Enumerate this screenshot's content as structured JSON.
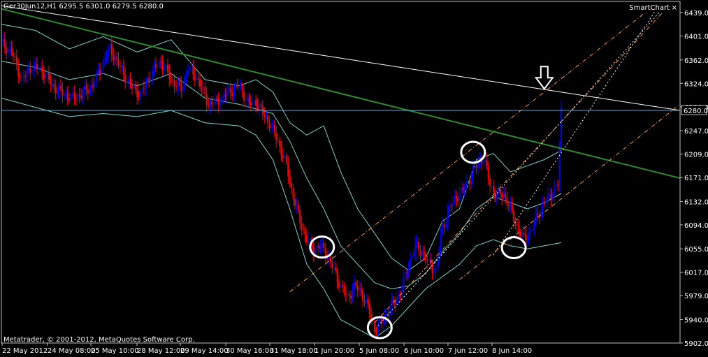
{
  "header": {
    "symbol_info": "Ger30Jun12,H1  6295.5 6301.0 6279.5 6280.0",
    "smartchart_label": "SmartChart",
    "close_glyph": "×"
  },
  "footer": {
    "copyright": "Metatrader, © 2001-2012, MetaQuotes Software Corp."
  },
  "colors": {
    "background": "#000000",
    "axis": "#c0c0c0",
    "bull_candle": "#0000ff",
    "bear_candle": "#ff0000",
    "bollinger": "#7fd3c8",
    "trend_green": "#2e8b2e",
    "trend_white": "#ffffff",
    "channel_orange": "#ff9933",
    "price_line": "#5aa9d6"
  },
  "chart_data": {
    "type": "candlestick",
    "ylim": [
      5902.0,
      6439.0
    ],
    "y_ticks": [
      "6439.0",
      "6401.0",
      "6362.0",
      "6324.0",
      "6286.0",
      "6247.0",
      "6209.0",
      "6171.0",
      "6132.0",
      "6094.0",
      "6055.0",
      "6017.0",
      "5979.0",
      "5940.0",
      "5902.0"
    ],
    "current_price": 6280.0,
    "current_price_label": "6280.0",
    "x_ticks": [
      "22 May 2012",
      "24 May 08:00",
      "25 May 10:00",
      "28 May 12:00",
      "29 May 14:00",
      "30 May 16:00",
      "31 May 18:00",
      "1 Jun 20:00",
      "5 Jun 08:00",
      "6 Jun 10:00",
      "7 Jun 12:00",
      "8 Jun 14:00"
    ],
    "close_path": [
      [
        0,
        6390
      ],
      [
        6,
        6375
      ],
      [
        12,
        6330
      ],
      [
        18,
        6352
      ],
      [
        24,
        6345
      ],
      [
        30,
        6320
      ],
      [
        36,
        6308
      ],
      [
        42,
        6300
      ],
      [
        48,
        6308
      ],
      [
        54,
        6322
      ],
      [
        60,
        6360
      ],
      [
        64,
        6380
      ],
      [
        70,
        6350
      ],
      [
        76,
        6320
      ],
      [
        82,
        6305
      ],
      [
        88,
        6340
      ],
      [
        94,
        6360
      ],
      [
        100,
        6330
      ],
      [
        106,
        6315
      ],
      [
        110,
        6350
      ],
      [
        116,
        6330
      ],
      [
        122,
        6290
      ],
      [
        128,
        6295
      ],
      [
        134,
        6310
      ],
      [
        140,
        6320
      ],
      [
        146,
        6290
      ],
      [
        150,
        6295
      ],
      [
        154,
        6275
      ],
      [
        158,
        6260
      ],
      [
        163,
        6230
      ],
      [
        168,
        6190
      ],
      [
        172,
        6140
      ],
      [
        176,
        6100
      ],
      [
        180,
        6070
      ],
      [
        184,
        6055
      ],
      [
        188,
        6060
      ],
      [
        192,
        6045
      ],
      [
        196,
        6020
      ],
      [
        200,
        5995
      ],
      [
        204,
        5975
      ],
      [
        208,
        5995
      ],
      [
        212,
        5985
      ],
      [
        216,
        5960
      ],
      [
        220,
        5925
      ],
      [
        224,
        5935
      ],
      [
        228,
        5955
      ],
      [
        232,
        5970
      ],
      [
        236,
        5990
      ],
      [
        240,
        6030
      ],
      [
        244,
        6060
      ],
      [
        248,
        6050
      ],
      [
        252,
        6030
      ],
      [
        256,
        6020
      ],
      [
        260,
        6090
      ],
      [
        264,
        6120
      ],
      [
        268,
        6140
      ],
      [
        272,
        6150
      ],
      [
        276,
        6170
      ],
      [
        280,
        6190
      ],
      [
        284,
        6205
      ],
      [
        288,
        6160
      ],
      [
        292,
        6140
      ],
      [
        296,
        6145
      ],
      [
        300,
        6120
      ],
      [
        304,
        6090
      ],
      [
        308,
        6070
      ],
      [
        312,
        6085
      ],
      [
        316,
        6110
      ],
      [
        320,
        6130
      ],
      [
        324,
        6145
      ],
      [
        328,
        6160
      ],
      [
        330,
        6280
      ]
    ],
    "band_upper": [
      [
        0,
        6420
      ],
      [
        20,
        6410
      ],
      [
        40,
        6380
      ],
      [
        60,
        6400
      ],
      [
        80,
        6375
      ],
      [
        100,
        6395
      ],
      [
        120,
        6330
      ],
      [
        140,
        6320
      ],
      [
        150,
        6330
      ],
      [
        160,
        6310
      ],
      [
        170,
        6260
      ],
      [
        180,
        6240
      ],
      [
        190,
        6255
      ],
      [
        200,
        6180
      ],
      [
        210,
        6120
      ],
      [
        220,
        6080
      ],
      [
        230,
        6040
      ],
      [
        240,
        6020
      ],
      [
        250,
        6040
      ],
      [
        260,
        6100
      ],
      [
        270,
        6120
      ],
      [
        280,
        6200
      ],
      [
        290,
        6210
      ],
      [
        300,
        6180
      ],
      [
        310,
        6190
      ],
      [
        320,
        6200
      ],
      [
        330,
        6215
      ]
    ],
    "band_middle": [
      [
        0,
        6360
      ],
      [
        20,
        6350
      ],
      [
        40,
        6330
      ],
      [
        60,
        6340
      ],
      [
        80,
        6320
      ],
      [
        100,
        6340
      ],
      [
        120,
        6300
      ],
      [
        140,
        6290
      ],
      [
        160,
        6275
      ],
      [
        170,
        6230
      ],
      [
        180,
        6170
      ],
      [
        190,
        6120
      ],
      [
        200,
        6060
      ],
      [
        210,
        6030
      ],
      [
        220,
        6000
      ],
      [
        230,
        5990
      ],
      [
        240,
        5995
      ],
      [
        250,
        6015
      ],
      [
        260,
        6050
      ],
      [
        270,
        6080
      ],
      [
        280,
        6120
      ],
      [
        290,
        6140
      ],
      [
        300,
        6130
      ],
      [
        310,
        6120
      ],
      [
        320,
        6130
      ],
      [
        330,
        6145
      ]
    ],
    "band_lower": [
      [
        0,
        6300
      ],
      [
        20,
        6285
      ],
      [
        40,
        6270
      ],
      [
        60,
        6275
      ],
      [
        80,
        6270
      ],
      [
        100,
        6280
      ],
      [
        120,
        6260
      ],
      [
        140,
        6255
      ],
      [
        150,
        6240
      ],
      [
        160,
        6200
      ],
      [
        170,
        6120
      ],
      [
        180,
        6030
      ],
      [
        190,
        5990
      ],
      [
        200,
        5940
      ],
      [
        210,
        5925
      ],
      [
        220,
        5910
      ],
      [
        230,
        5930
      ],
      [
        240,
        5960
      ],
      [
        250,
        5990
      ],
      [
        260,
        6010
      ],
      [
        270,
        6030
      ],
      [
        280,
        6060
      ],
      [
        290,
        6070
      ],
      [
        300,
        6060
      ],
      [
        310,
        6055
      ],
      [
        320,
        6060
      ],
      [
        330,
        6065
      ]
    ],
    "trendlines": [
      {
        "color": "green",
        "from": [
          0,
          6445
        ],
        "to": [
          400,
          6170
        ]
      },
      {
        "color": "white",
        "from": [
          0,
          6450
        ],
        "to": [
          400,
          6280
        ]
      }
    ],
    "channel_lines": [
      {
        "color": "orange",
        "dash": "dashdot",
        "from": [
          220,
          5935
        ],
        "to": [
          390,
          6440
        ]
      },
      {
        "color": "orange",
        "dash": "dashdot",
        "from": [
          170,
          5985
        ],
        "to": [
          380,
          6440
        ]
      },
      {
        "color": "orange",
        "dash": "dashdot",
        "from": [
          270,
          6005
        ],
        "to": [
          400,
          6290
        ]
      }
    ],
    "dotted_lines": [
      {
        "color": "white",
        "from": [
          222,
          5930
        ],
        "to": [
          388,
          6440
        ]
      },
      {
        "color": "white",
        "from": [
          290,
          6045
        ],
        "to": [
          385,
          6440
        ]
      }
    ],
    "circles": [
      [
        189,
        6058
      ],
      [
        223,
        5927
      ],
      [
        278,
        6212
      ],
      [
        302,
        6057
      ]
    ],
    "arrow_at": [
      320,
      6315
    ],
    "x_max": 400
  }
}
